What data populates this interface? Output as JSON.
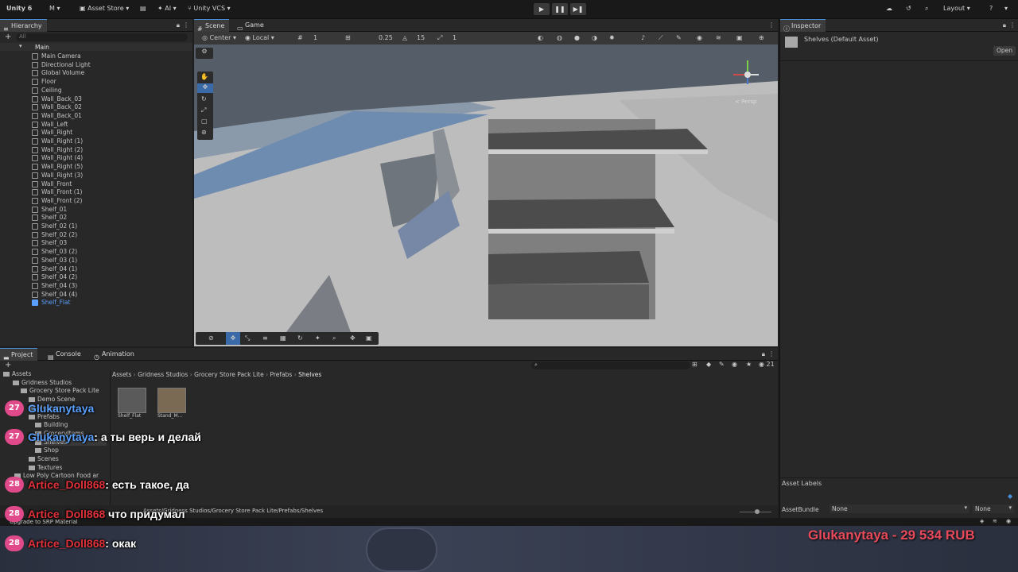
{
  "toolbar": {
    "app_name": "Unity 6",
    "account": "M",
    "asset_store": "Asset Store",
    "ai": "AI",
    "vcs": "Unity VCS",
    "layout": "Layout"
  },
  "hierarchy": {
    "tab": "Hierarchy",
    "search_placeholder": "All",
    "scene_name": "Main",
    "items": [
      "Main Camera",
      "Directional Light",
      "Global Volume",
      "Floor",
      "Ceiling",
      "Wall_Back_03",
      "Wall_Back_02",
      "Wall_Back_01",
      "Wall_Left",
      "Wall_Right",
      "Wall_Right (1)",
      "Wall_Right (2)",
      "Wall_Right (4)",
      "Wall_Right (5)",
      "Wall_Right (3)",
      "Wall_Front",
      "Wall_Front (1)",
      "Wall_Front (2)",
      "Shelf_01",
      "Shelf_02",
      "Shelf_02 (1)",
      "Shelf_02 (2)",
      "Shelf_03",
      "Shelf_03 (2)",
      "Shelf_03 (1)",
      "Shelf_04 (1)",
      "Shelf_04 (2)",
      "Shelf_04 (3)",
      "Shelf_04 (4)",
      "Shelf_Flat"
    ],
    "selected": "Shelf_Flat"
  },
  "scene": {
    "tab_scene": "Scene",
    "tab_game": "Game",
    "pivot": "Center",
    "space": "Local",
    "grid_value": "1",
    "snap_value": "0.25",
    "angle_value": "15",
    "scale_value": "1",
    "persp_label": "< Persp"
  },
  "inspector": {
    "tab": "Inspector",
    "asset_title": "Shelves (Default Asset)",
    "open_button": "Open",
    "asset_labels": "Asset Labels",
    "asset_bundle": "AssetBundle",
    "bundle_value": "None",
    "variant_value": "None"
  },
  "bottom": {
    "tab_project": "Project",
    "tab_console": "Console",
    "tab_animation": "Animation",
    "count": "21",
    "breadcrumb": [
      "Assets",
      "Gridness Studios",
      "Grocery Store Pack Lite",
      "Prefabs",
      "Shelves"
    ],
    "status_path": "Assets/Gridness Studios/Grocery Store Pack Lite/Prefabs/Shelves",
    "upgrade_text": "Upgrade to SRP Material",
    "tree": [
      "Assets",
      "Gridness Studios",
      "Grocery Store Pack Lite",
      "Demo Scene",
      "Meshes",
      "Prefabs",
      "Building",
      "GroceryItems",
      "Shelves",
      "Shop",
      "Scenes",
      "Textures",
      "Low Poly Cartoon Food ar"
    ],
    "prefabs": [
      "Shelf_Flat",
      "Stand_M..."
    ]
  },
  "chat": [
    {
      "badge": "27",
      "user": "Glukanytaya",
      "text": "",
      "user_color": "#5aa0ff"
    },
    {
      "badge": "27",
      "user": "Glukanytaya",
      "text": ": а ты верь и делай",
      "user_color": "#5aa0ff"
    },
    {
      "badge": "28",
      "user": "Artice_Doll868",
      "text": ": есть такое, да",
      "user_color": "#e0303a"
    },
    {
      "badge": "28",
      "user": "Artice_Doll868",
      "text": " что придумал",
      "user_color": "#e0303a"
    },
    {
      "badge": "28",
      "user": "Artice_Doll868",
      "text": ": окак",
      "user_color": "#e0303a"
    }
  ],
  "donation": "Glukanytaya - 29 534 RUB",
  "colors": {
    "selected_blue": "#3a78c8",
    "donation_red": "#e84a5a",
    "badge_pink": "#e04a8a"
  }
}
